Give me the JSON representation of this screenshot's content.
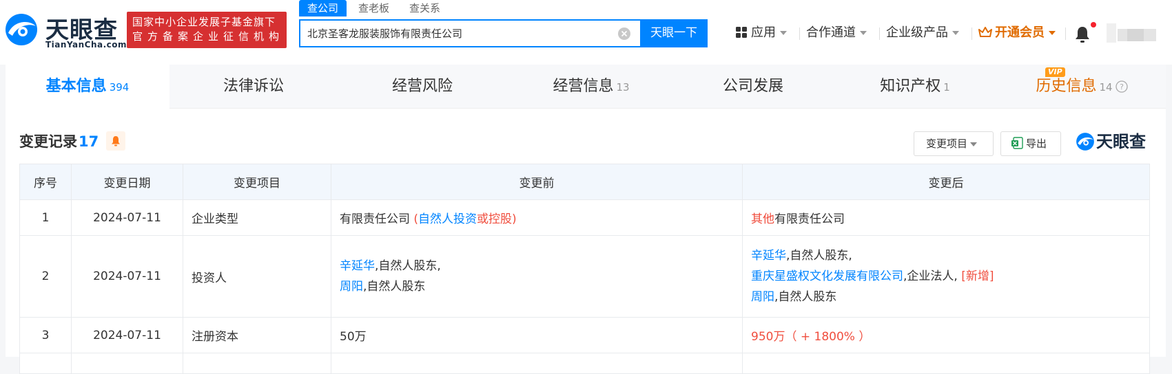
{
  "header": {
    "logo_cn": "天眼查",
    "logo_en": "TianYanCha.com",
    "badge_line1": "国家中小企业发展子基金旗下",
    "badge_line2": "官方备案企业征信机构",
    "search_tabs": [
      "查公司",
      "查老板",
      "查关系"
    ],
    "search_value": "北京圣客龙服装服饰有限责任公司",
    "search_button": "天眼一下",
    "nav": {
      "apps": "应用",
      "partner": "合作通道",
      "enterprise": "企业级产品",
      "vip": "开通会员"
    }
  },
  "tabs": [
    {
      "label": "基本信息",
      "count": "394"
    },
    {
      "label": "法律诉讼",
      "count": ""
    },
    {
      "label": "经营风险",
      "count": ""
    },
    {
      "label": "经营信息",
      "count": "13"
    },
    {
      "label": "公司发展",
      "count": ""
    },
    {
      "label": "知识产权",
      "count": "1"
    },
    {
      "label": "历史信息",
      "count": "14"
    }
  ],
  "vip_tag": "VIP",
  "section": {
    "title": "变更记录",
    "count": "17",
    "filter_button": "变更项目",
    "export_button": "导出",
    "watermark": "天眼查"
  },
  "table": {
    "headers": [
      "序号",
      "变更日期",
      "变更项目",
      "变更前",
      "变更后"
    ],
    "rows": [
      {
        "no": "1",
        "date": "2024-07-11",
        "item": "企业类型",
        "before": {
          "a": "有限责任公司",
          "b": "(",
          "c": "自然人投资",
          "d": "或控股)"
        },
        "after": {
          "a": "其他",
          "b": "有限责任公司"
        }
      },
      {
        "no": "2",
        "date": "2024-07-11",
        "item": "投资人",
        "before": {
          "l1_name": "辛延华",
          "l1_rest": ",自然人股东,",
          "l2_name": "周阳",
          "l2_rest": ",自然人股东"
        },
        "after": {
          "l1_name": "辛延华",
          "l1_rest": ",自然人股东,",
          "l2_name": "重庆星盛权文化发展有限公司",
          "l2_rest": ",企业法人, ",
          "l2_tag": "[新增]",
          "l3_name": "周阳",
          "l3_rest": ",自然人股东"
        }
      },
      {
        "no": "3",
        "date": "2024-07-11",
        "item": "注册资本",
        "before": {
          "a": "50万"
        },
        "after": {
          "a": "950万（ + 1800% ）"
        }
      }
    ]
  },
  "colors": {
    "brand_blue": "#0084ff",
    "badge_red": "#d63031",
    "vip_orange": "#e06b00",
    "change_red": "#f04e3e"
  },
  "icons": {
    "logo": "tianyancha-eye-logo",
    "clear": "clear-icon",
    "apps": "grid-icon",
    "vip": "crown-icon",
    "bell": "bell-icon",
    "help": "question-icon",
    "excel": "excel-icon"
  }
}
